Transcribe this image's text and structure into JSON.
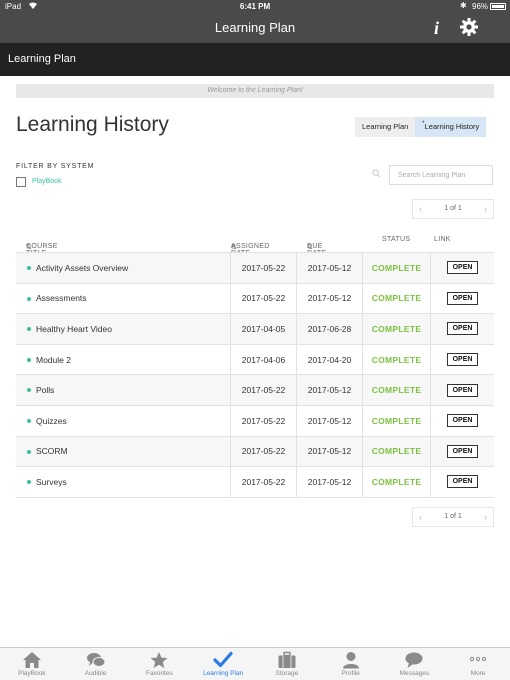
{
  "status_bar": {
    "device": "iPad",
    "time": "6:41 PM",
    "battery": "96%"
  },
  "nav": {
    "title": "Learning Plan"
  },
  "section": {
    "title": "Learning Plan"
  },
  "welcome": "Welcome to the Learning Plan!",
  "heading": "Learning History",
  "tabs": [
    {
      "label": "Learning Plan",
      "active": false
    },
    {
      "label": "Learning History",
      "active": true
    }
  ],
  "filter": {
    "label": "FILTER BY SYSTEM",
    "option": "PlayBook",
    "checked": false
  },
  "search": {
    "placeholder": "Search Learning Plan"
  },
  "pagination": {
    "page_text": "1 of 1"
  },
  "table": {
    "headers": [
      "COURSE TITLE",
      "ASSIGNED DATE",
      "DUE DATE",
      "STATUS",
      "LINK"
    ],
    "sort_glyph": "⇅",
    "rows": [
      {
        "title": "Activity Assets Overview",
        "assigned": "2017-05-22",
        "due": "2017-05-12",
        "status": "COMPLETE",
        "link": "OPEN"
      },
      {
        "title": "Assessments",
        "assigned": "2017-05-22",
        "due": "2017-05-12",
        "status": "COMPLETE",
        "link": "OPEN"
      },
      {
        "title": "Healthy Heart Video",
        "assigned": "2017-04-05",
        "due": "2017-06-28",
        "status": "COMPLETE",
        "link": "OPEN"
      },
      {
        "title": "Module 2",
        "assigned": "2017-04-06",
        "due": "2017-04-20",
        "status": "COMPLETE",
        "link": "OPEN"
      },
      {
        "title": "Polls",
        "assigned": "2017-05-22",
        "due": "2017-05-12",
        "status": "COMPLETE",
        "link": "OPEN"
      },
      {
        "title": "Quizzes",
        "assigned": "2017-05-22",
        "due": "2017-05-12",
        "status": "COMPLETE",
        "link": "OPEN"
      },
      {
        "title": "SCORM",
        "assigned": "2017-05-22",
        "due": "2017-05-12",
        "status": "COMPLETE",
        "link": "OPEN"
      },
      {
        "title": "Surveys",
        "assigned": "2017-05-22",
        "due": "2017-05-12",
        "status": "COMPLETE",
        "link": "OPEN"
      }
    ]
  },
  "tab_bar": [
    {
      "label": "PlayBook",
      "icon": "home-icon",
      "active": false
    },
    {
      "label": "Audible",
      "icon": "chat-bubbles-icon",
      "active": false
    },
    {
      "label": "Favorites",
      "icon": "star-icon",
      "active": false
    },
    {
      "label": "Learning Plan",
      "icon": "checkmark-icon",
      "active": true
    },
    {
      "label": "Storage",
      "icon": "briefcase-icon",
      "active": false
    },
    {
      "label": "Profile",
      "icon": "person-icon",
      "active": false
    },
    {
      "label": "Messages",
      "icon": "message-icon",
      "active": false
    },
    {
      "label": "More",
      "icon": "more-dots-icon",
      "active": false
    }
  ],
  "colors": {
    "accent": "#3cbf9a",
    "complete": "#7cc142",
    "active_tab": "#2c7be5",
    "nav_bg": "#4a4a4a",
    "section_bg": "#222222"
  }
}
